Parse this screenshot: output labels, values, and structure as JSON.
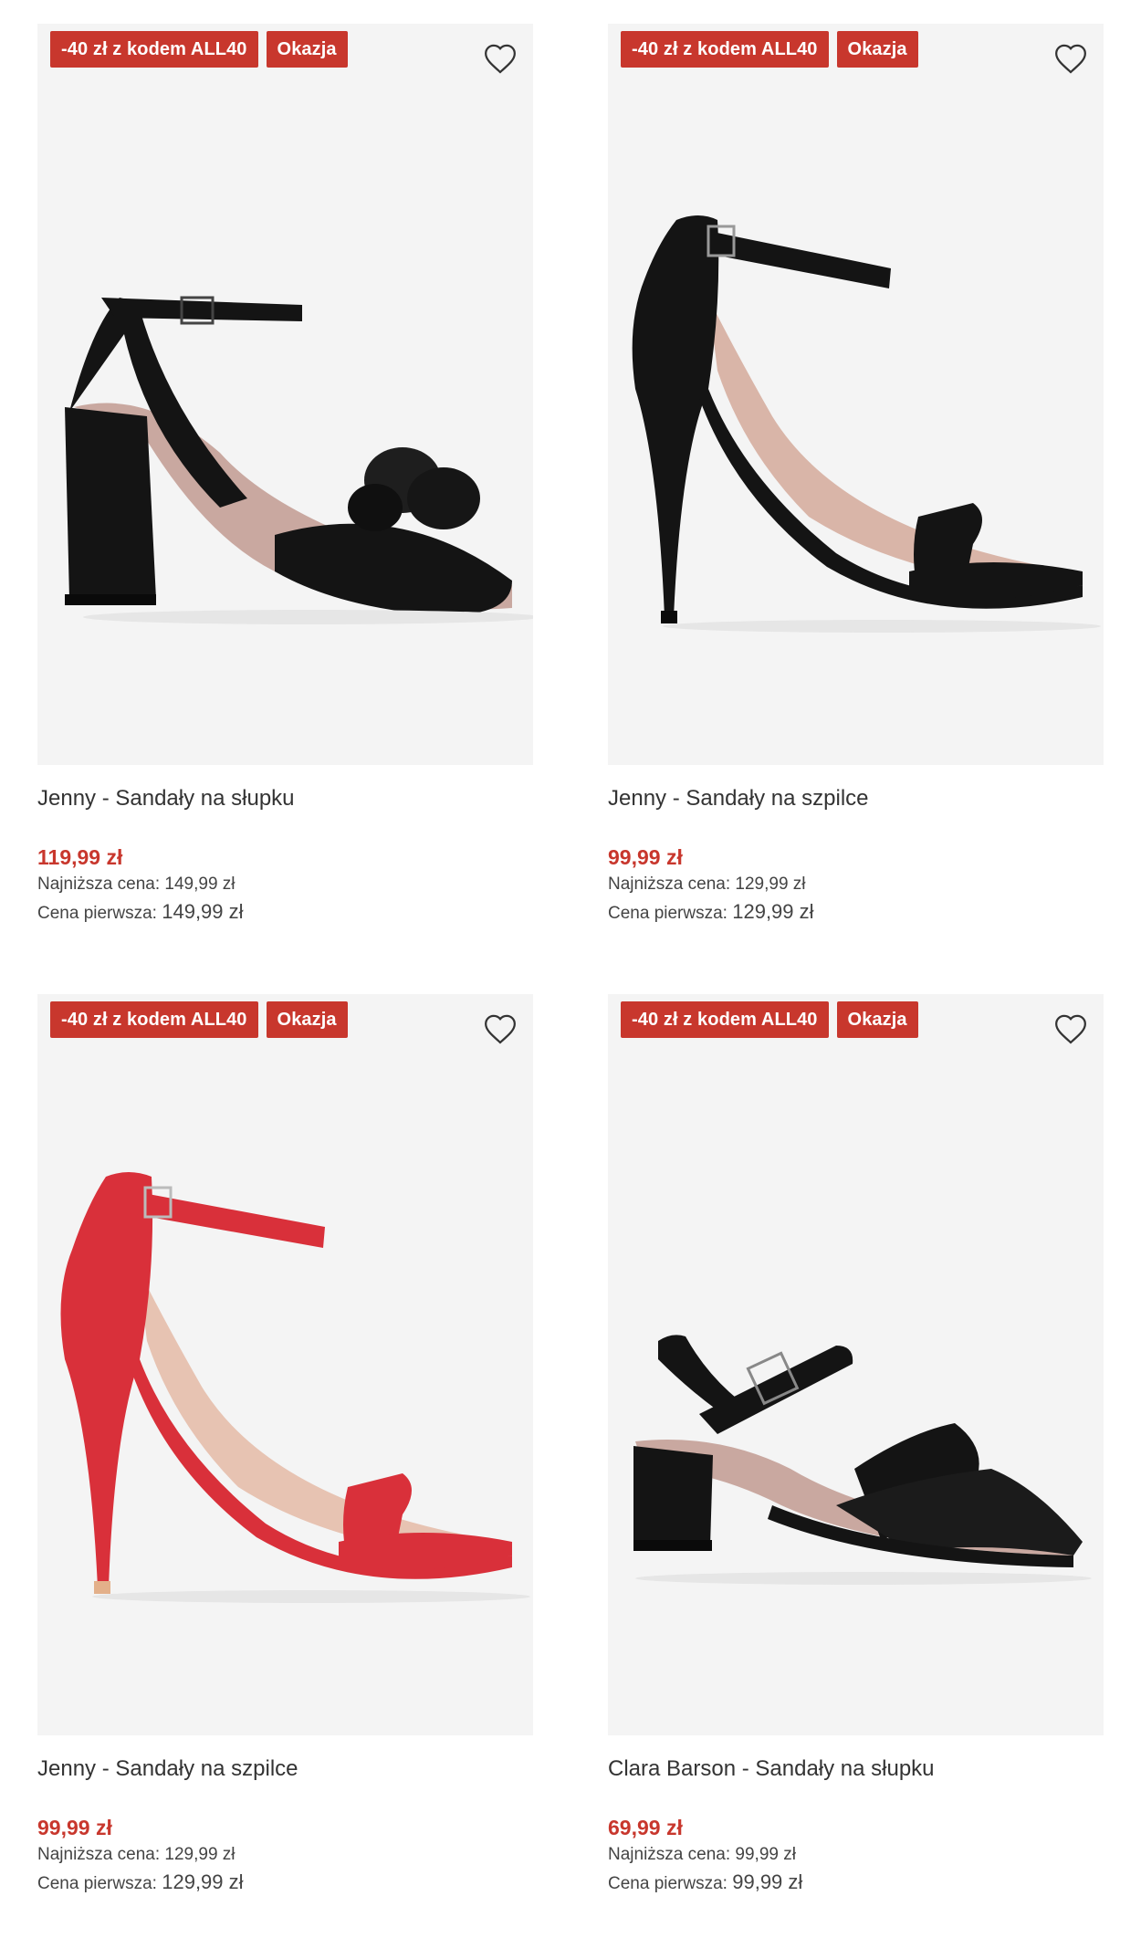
{
  "products": [
    {
      "badge_code": "-40 zł z kodem ALL40",
      "badge_deal": "Okazja",
      "name": "Jenny - Sandały na słupku",
      "price": "119,99 zł",
      "lowest_label": "Najniższa cena:",
      "lowest_value": "149,99 zł",
      "first_label": "Cena pierwsza:",
      "first_value": "149,99 zł",
      "shoe_color": "#141414",
      "shoe_style": "block-heel-bow"
    },
    {
      "badge_code": "-40 zł z kodem ALL40",
      "badge_deal": "Okazja",
      "name": "Jenny - Sandały na szpilce",
      "price": "99,99 zł",
      "lowest_label": "Najniższa cena:",
      "lowest_value": "129,99 zł",
      "first_label": "Cena pierwsza:",
      "first_value": "129,99 zł",
      "shoe_color": "#141414",
      "shoe_style": "stiletto"
    },
    {
      "badge_code": "-40 zł z kodem ALL40",
      "badge_deal": "Okazja",
      "name": "Jenny - Sandały na szpilce",
      "price": "99,99 zł",
      "lowest_label": "Najniższa cena:",
      "lowest_value": "129,99 zł",
      "first_label": "Cena pierwsza:",
      "first_value": "129,99 zł",
      "shoe_color": "#d9303a",
      "shoe_style": "stiletto"
    },
    {
      "badge_code": "-40 zł z kodem ALL40",
      "badge_deal": "Okazja",
      "name": "Clara Barson - Sandały na słupku",
      "price": "69,99 zł",
      "lowest_label": "Najniższa cena:",
      "lowest_value": "99,99 zł",
      "first_label": "Cena pierwsza:",
      "first_value": "99,99 zł",
      "shoe_color": "#141414",
      "shoe_style": "block-heel-cross"
    }
  ],
  "icons": {
    "favorite": "heart-outline-icon"
  },
  "colors": {
    "accent": "#c8372d",
    "image_bg": "#f4f4f4"
  }
}
